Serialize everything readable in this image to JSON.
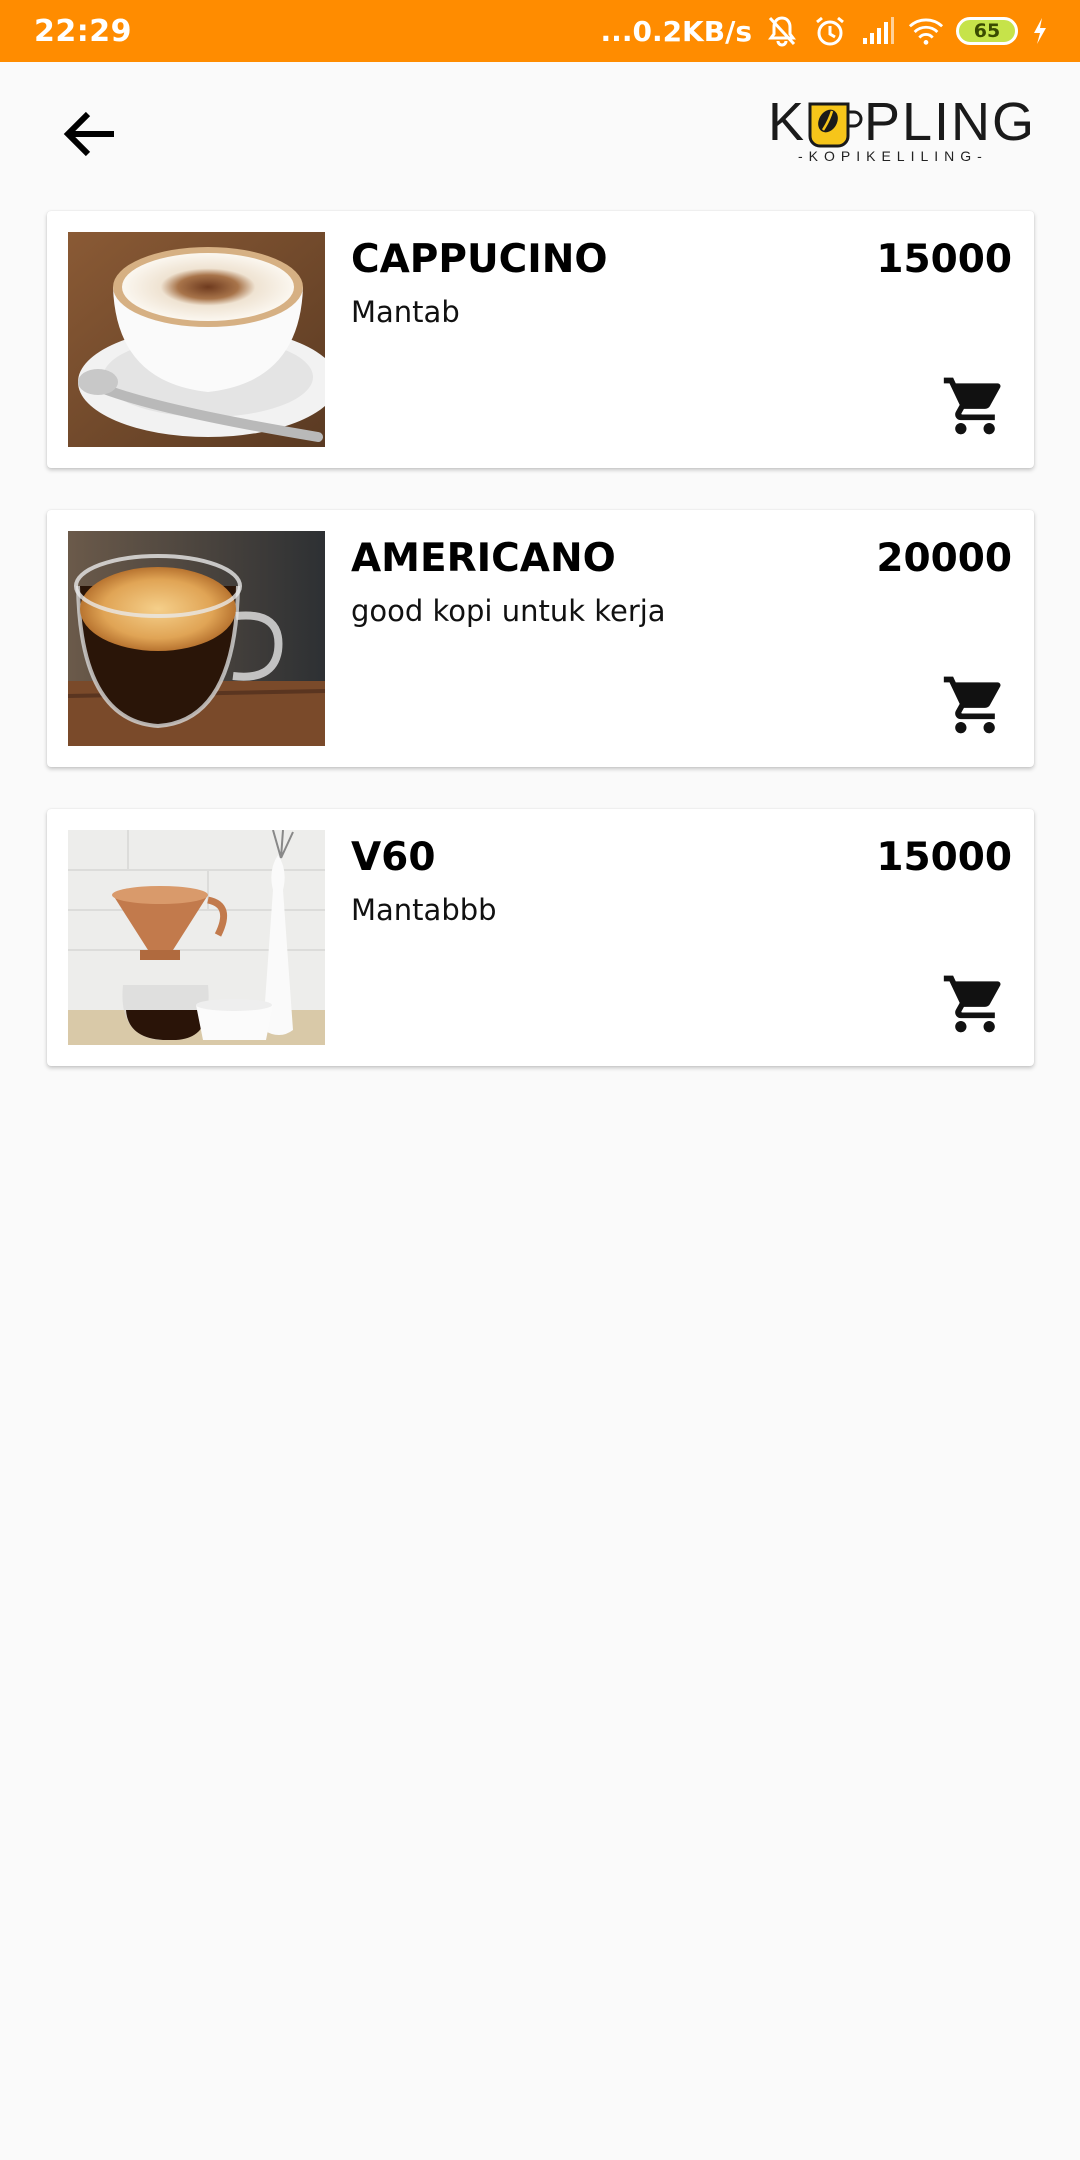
{
  "status_bar": {
    "time": "22:29",
    "network_speed": "...0.2KB/s",
    "battery_level": "65",
    "background_color": "#ff8c00",
    "icons": [
      "mute-bell-icon",
      "alarm-icon",
      "signal-icon",
      "wifi-icon",
      "battery-icon",
      "charging-icon"
    ]
  },
  "app_bar": {
    "back_icon": "arrow-left-icon",
    "logo": {
      "letter_k": "K",
      "letters_pling": "PLING",
      "subtitle": "-KOPIKELILING-"
    }
  },
  "products": [
    {
      "name": "CAPPUCINO",
      "description": "Mantab",
      "price": "15000",
      "image": "cappuccino-photo",
      "cart_icon": "cart-icon"
    },
    {
      "name": "AMERICANO",
      "description": "good kopi untuk kerja",
      "price": "20000",
      "image": "americano-photo",
      "cart_icon": "cart-icon"
    },
    {
      "name": "V60",
      "description": "Mantabbb",
      "price": "15000",
      "image": "v60-photo",
      "cart_icon": "cart-icon"
    }
  ]
}
